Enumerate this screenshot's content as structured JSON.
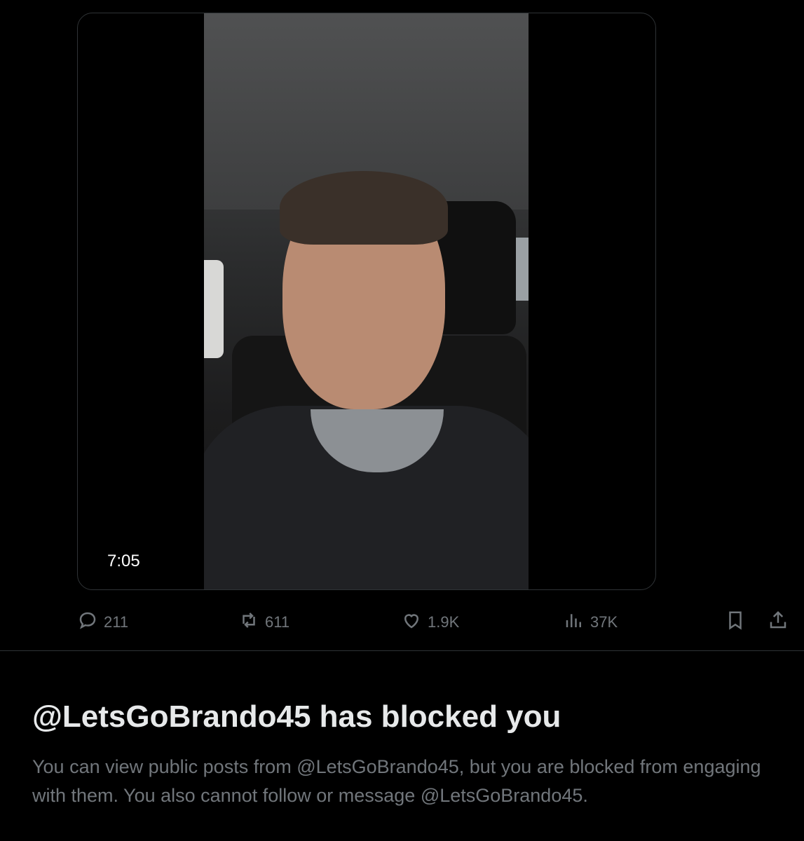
{
  "video": {
    "duration": "7:05"
  },
  "actions": {
    "reply": {
      "icon": "reply-icon",
      "count": "211"
    },
    "repost": {
      "icon": "repost-icon",
      "count": "611"
    },
    "like": {
      "icon": "heart-icon",
      "count": "1.9K"
    },
    "views": {
      "icon": "analytics-icon",
      "count": "37K"
    },
    "bookmark": {
      "icon": "bookmark-icon"
    },
    "share": {
      "icon": "share-icon"
    }
  },
  "blocked": {
    "title": "@LetsGoBrando45 has blocked you",
    "description": "You can view public posts from @LetsGoBrando45, but you are blocked from engaging with them. You also cannot follow or message @LetsGoBrando45."
  },
  "colors": {
    "background": "#000000",
    "text": "#e7e9ea",
    "muted": "#71767b",
    "border": "#2f3336"
  }
}
